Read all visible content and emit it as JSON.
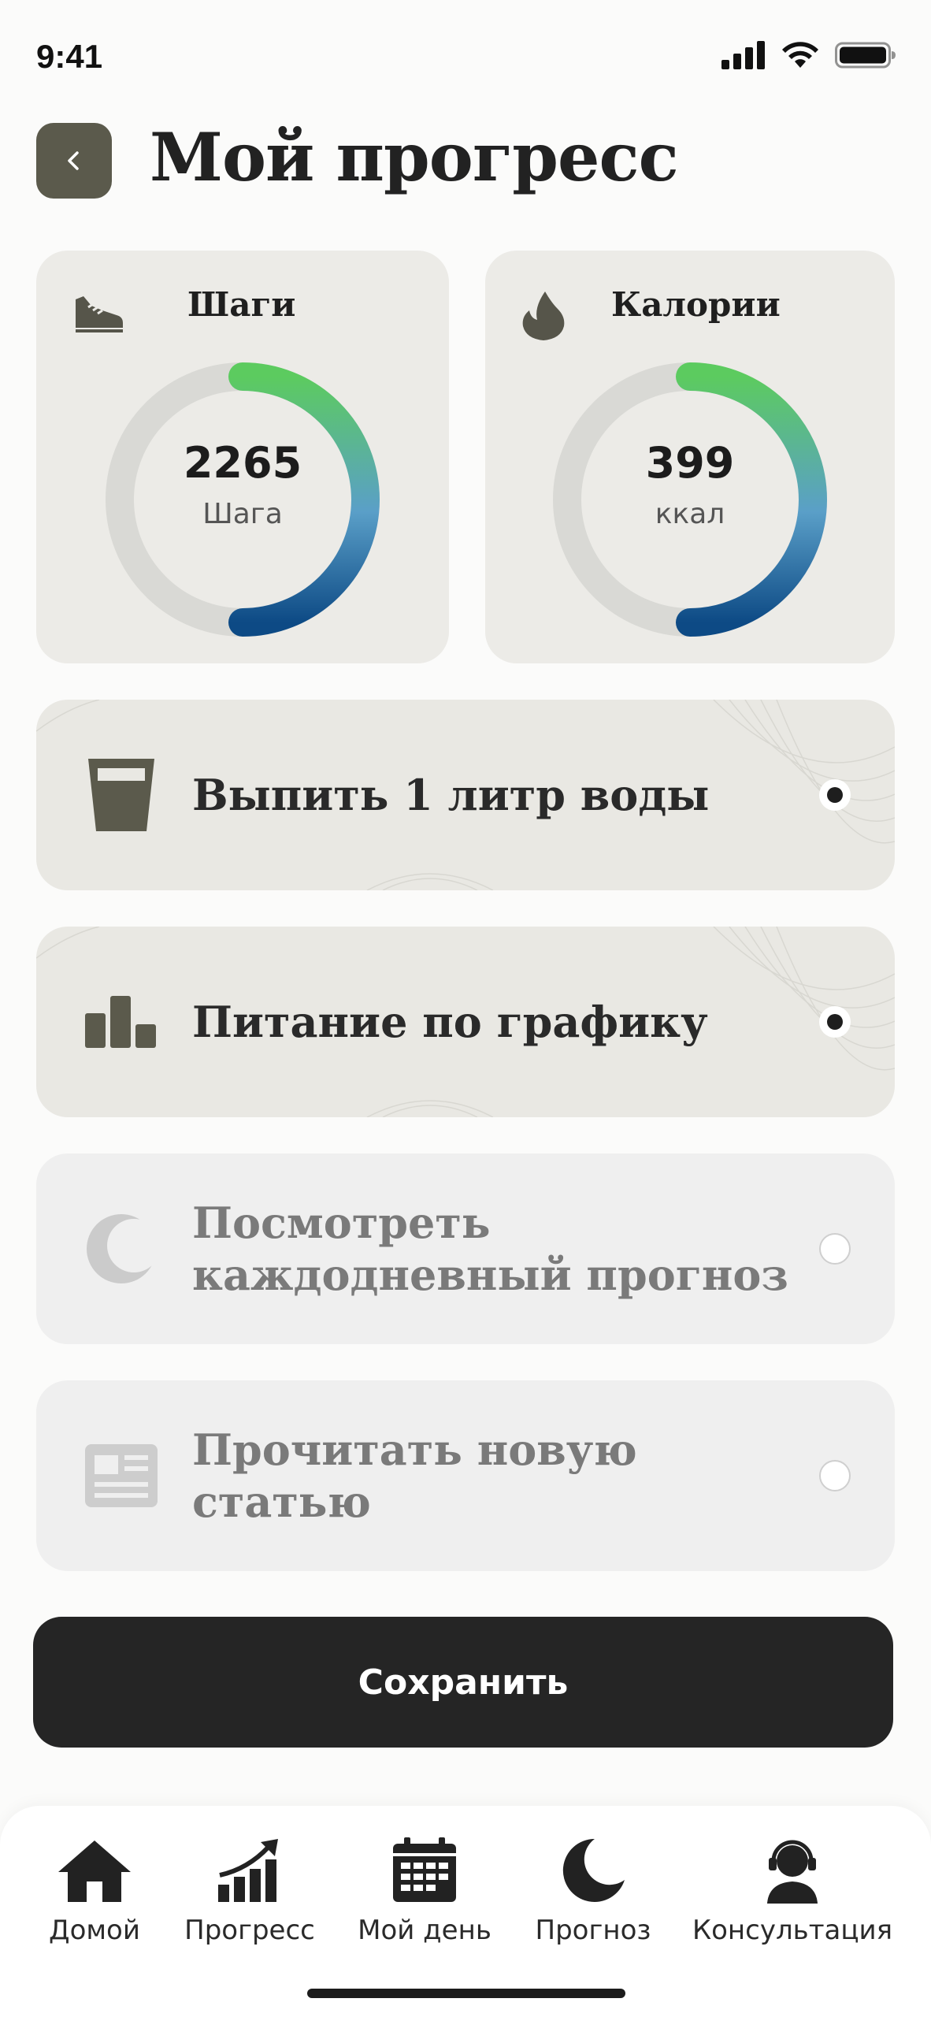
{
  "status": {
    "time": "9:41"
  },
  "header": {
    "title": "Мой прогресс"
  },
  "stats": {
    "steps": {
      "label": "Шаги",
      "value": "2265",
      "unit": "Шага",
      "progress": 0.5
    },
    "calories": {
      "label": "Калории",
      "value": "399",
      "unit": "ккал",
      "progress": 0.5
    }
  },
  "tasks": [
    {
      "text": "Выпить 1 литр воды",
      "done": true,
      "icon": "water-glass-icon"
    },
    {
      "text": "Питание по графику",
      "done": true,
      "icon": "bar-chart-icon"
    },
    {
      "text": "Посмотреть каждодневный прогноз",
      "done": false,
      "icon": "moon-icon"
    },
    {
      "text": "Прочитать новую статью",
      "done": false,
      "icon": "article-icon"
    }
  ],
  "actions": {
    "save_label": "Сохранить"
  },
  "nav": {
    "items": [
      {
        "label": "Домой",
        "icon": "home-icon"
      },
      {
        "label": "Прогресс",
        "icon": "progress-icon"
      },
      {
        "label": "Мой день",
        "icon": "calendar-icon"
      },
      {
        "label": "Прогноз",
        "icon": "moon-icon"
      },
      {
        "label": "Консультация",
        "icon": "support-icon"
      }
    ]
  },
  "colors": {
    "ring_start": "#5ccb5f",
    "ring_mid": "#5a9fc8",
    "ring_end": "#0d4a85",
    "ring_track": "#d9d9d5",
    "card_bg": "#ecebe7",
    "accent_dark": "#5b5a4c",
    "button_dark": "#252525"
  }
}
